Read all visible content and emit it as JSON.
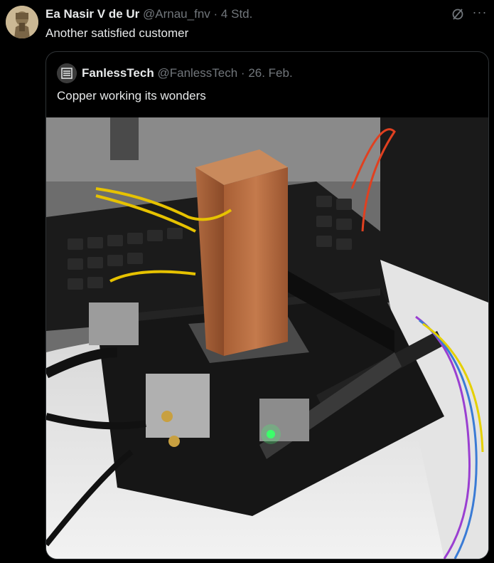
{
  "tweet": {
    "author_name": "Ea Nasir V de Ur",
    "author_handle": "@Arnau_fnv",
    "separator": "·",
    "time": "4 Std.",
    "text": "Another satisfied customer",
    "more_label": "···"
  },
  "quoted_tweet": {
    "author_name": "FanlessTech",
    "author_handle": "@FanlessTech",
    "separator": "·",
    "date": "26. Feb.",
    "text": "Copper working its wonders"
  },
  "colors": {
    "background": "#000000",
    "text_primary": "#e7e9ea",
    "text_secondary": "#71767b",
    "border": "#2f3336"
  },
  "icons": [
    "grok-slash-icon",
    "more-icon",
    "avatar",
    "fanlesstech-logo-icon"
  ]
}
